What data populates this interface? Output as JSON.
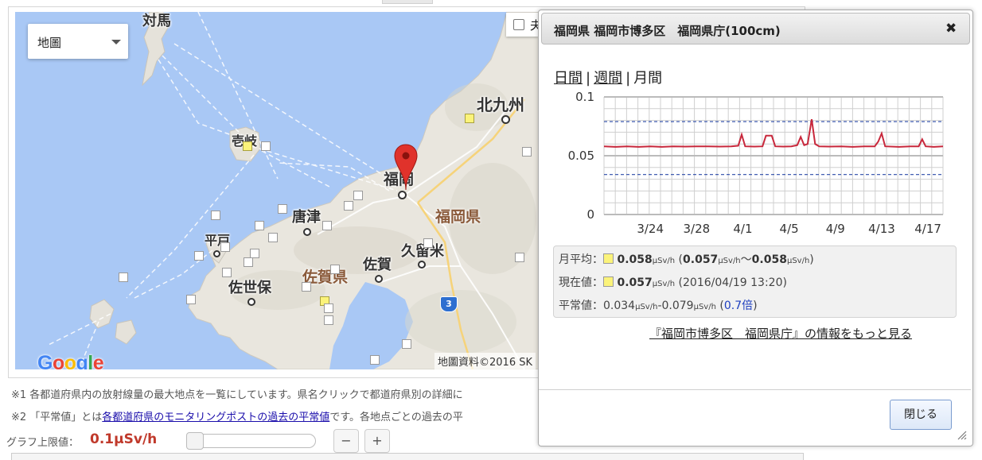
{
  "map": {
    "type_select": "地圖",
    "checkbox_label": "夫",
    "logo": "Google",
    "attribution": "地圖資料©2016 SK",
    "place_labels": {
      "tsushima": "対馬",
      "iki": "壱岐",
      "kitakyushu": "北九州",
      "fukuoka": "福岡",
      "fukuoka_pref": "福岡県",
      "karatsu": "唐津",
      "hirado": "平戸",
      "kurume": "久留米",
      "saga": "佐賀",
      "saga_pref": "佐賀県",
      "sasebo": "佐世保",
      "route_shield": "3"
    }
  },
  "notes": {
    "note1": "※1 各都道府県内の放射線量の最大地点を一覧にしています。県名クリックで都道府県別の詳細に",
    "note2_prefix": "※2 「平常値」とは",
    "note2_link": "各都道府県のモニタリングポストの過去の平常値",
    "note2_suffix": "です。各地点ごとの過去の平"
  },
  "graph_limit": {
    "label": "グラフ上限値：",
    "value": "0.1μSv/h",
    "minus": "−",
    "plus": "+",
    "slider_fraction": 0.0
  },
  "dialog": {
    "title": "福岡県 福岡市博多区　福岡県庁(100cm)",
    "close_icon": "✖",
    "tabs": {
      "daily": "日間",
      "weekly": "週間",
      "monthly": "月間",
      "sep": "|"
    },
    "stats": {
      "avg_label": "月平均：",
      "avg_value": "0.058",
      "avg_range_open": "(",
      "avg_min": "0.057",
      "avg_tilde": "〜",
      "avg_max": "0.058",
      "avg_range_close": ")",
      "unit": "μSv/h",
      "cur_label": "現在値：",
      "cur_value": "0.057",
      "cur_time": "(2016/04/19 13:20)",
      "norm_label": "平常値：",
      "norm_min": "0.034",
      "norm_dash": "-",
      "norm_max": "0.079",
      "norm_ratio_open": "(",
      "norm_ratio": "0.7倍",
      "norm_ratio_close": ")"
    },
    "more_link": "『福岡市博多区　福岡県庁』の情報をもっと見る",
    "close_button": "閉じる"
  },
  "chart_data": {
    "type": "line",
    "title": "",
    "xlabel": "",
    "ylabel": "",
    "ylim": [
      0,
      0.1
    ],
    "y_ticks": [
      "0.1",
      "0.05",
      "0"
    ],
    "x_ticks": [
      {
        "label": "3/24",
        "day": 4
      },
      {
        "label": "3/28",
        "day": 8
      },
      {
        "label": "4/1",
        "day": 12
      },
      {
        "label": "4/5",
        "day": 16
      },
      {
        "label": "4/9",
        "day": 20
      },
      {
        "label": "4/13",
        "day": 24
      },
      {
        "label": "4/17",
        "day": 28
      }
    ],
    "x_range_days": [
      0,
      29.3
    ],
    "reference_lines": [
      0.079,
      0.034
    ],
    "grid": true,
    "series": [
      {
        "color": "#c8283c",
        "points": [
          [
            0,
            0.058
          ],
          [
            1,
            0.0575
          ],
          [
            2,
            0.058
          ],
          [
            3,
            0.0575
          ],
          [
            4,
            0.058
          ],
          [
            5,
            0.0575
          ],
          [
            6,
            0.058
          ],
          [
            7,
            0.0578
          ],
          [
            8,
            0.058
          ],
          [
            9,
            0.058
          ],
          [
            10,
            0.0578
          ],
          [
            11,
            0.058
          ],
          [
            11.6,
            0.0585
          ],
          [
            11.9,
            0.068
          ],
          [
            12.2,
            0.058
          ],
          [
            13,
            0.0578
          ],
          [
            13.7,
            0.058
          ],
          [
            14.0,
            0.067
          ],
          [
            14.5,
            0.067
          ],
          [
            14.8,
            0.058
          ],
          [
            15.5,
            0.0578
          ],
          [
            16.2,
            0.058
          ],
          [
            16.7,
            0.059
          ],
          [
            17.0,
            0.066
          ],
          [
            17.3,
            0.059
          ],
          [
            17.6,
            0.06
          ],
          [
            17.95,
            0.081
          ],
          [
            18.25,
            0.06
          ],
          [
            18.6,
            0.058
          ],
          [
            19.5,
            0.0578
          ],
          [
            20.5,
            0.058
          ],
          [
            21.5,
            0.0575
          ],
          [
            22.5,
            0.058
          ],
          [
            23.4,
            0.058
          ],
          [
            23.7,
            0.062
          ],
          [
            24.0,
            0.069
          ],
          [
            24.3,
            0.058
          ],
          [
            25.5,
            0.0575
          ],
          [
            26.5,
            0.058
          ],
          [
            27.2,
            0.058
          ],
          [
            27.5,
            0.064
          ],
          [
            27.8,
            0.058
          ],
          [
            28.5,
            0.0575
          ],
          [
            29.3,
            0.058
          ]
        ]
      }
    ]
  },
  "colors": {
    "sea": "#a9c8f5",
    "land": "#e9e6de",
    "accent_red": "#c0392b",
    "marker_red": "#e0322b"
  }
}
